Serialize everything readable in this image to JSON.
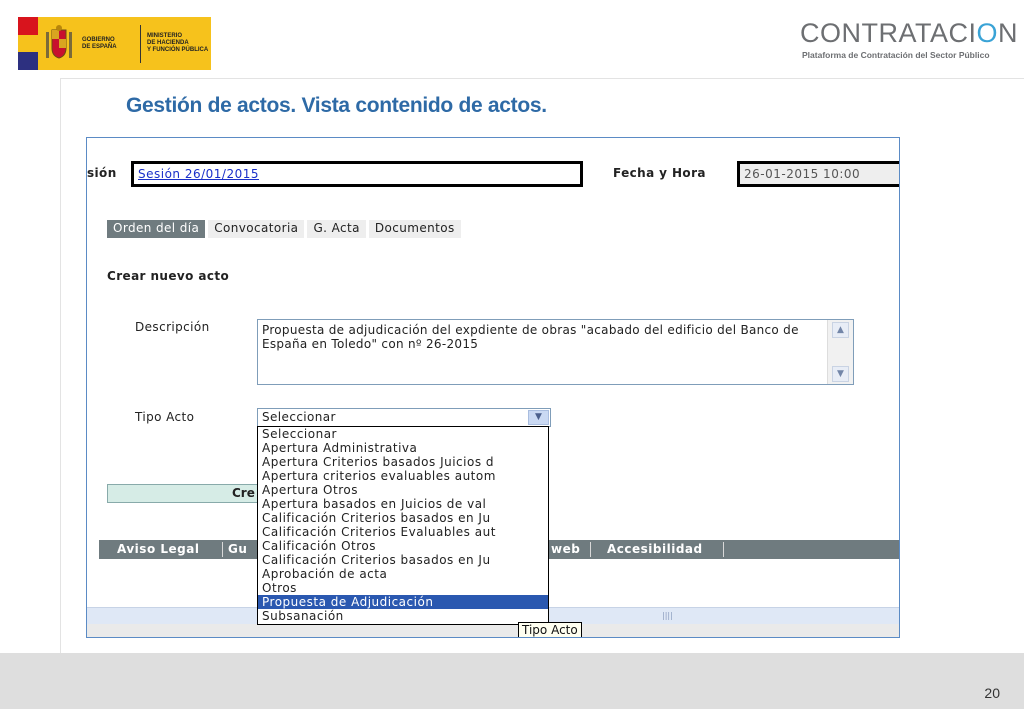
{
  "colors": {
    "title": "#2e6aa6",
    "tab_active": "#6f7b7f",
    "link": "#1a2fc9",
    "selected": "#2a58b0"
  },
  "header": {
    "gov_logo": {
      "line1": "GOBIERNO",
      "line2": "DE ESPAÑA",
      "line3": "MINISTERIO",
      "line4": "DE HACIENDA",
      "line5": "Y FUNCIÓN PÚBLICA"
    },
    "brand": {
      "title_main": "CONTRATACI",
      "title_power": "O",
      "title_end": "N",
      "subtitle": "Plataforma de Contratación del Sector Público"
    }
  },
  "slide": {
    "title": "Gestión de actos. Vista contenido de actos.",
    "page_number": "20"
  },
  "form": {
    "session_label": "sión",
    "session_value": "Sesión 26/01/2015",
    "date_label": "Fecha y Hora",
    "date_value": "26-01-2015 10:00",
    "tabs": [
      {
        "label": "Orden del día",
        "active": true
      },
      {
        "label": "Convocatoria",
        "active": false
      },
      {
        "label": "G. Acta",
        "active": false
      },
      {
        "label": "Documentos",
        "active": false
      }
    ],
    "section_title": "Crear nuevo acto",
    "description_label": "Descripción",
    "description_value": "Propuesta de adjudicación del expdiente de obras \"acabado del edificio del Banco de España en Toledo\" con nº 26-2015",
    "type_label": "Tipo Acto",
    "type_selected": "Seleccionar",
    "create_button_label": "Cre",
    "type_options": [
      "Seleccionar",
      "Apertura Administrativa",
      "Apertura Criterios basados Juicios d",
      "Apertura criterios evaluables autom",
      "Apertura Otros",
      "Apertura basados en Juicios de val",
      "Calificación Criterios basados en Ju",
      "Calificación Criterios Evaluables aut",
      "Calificación Otros",
      "Calificación Criterios basados en Ju",
      "Aprobación de acta",
      "Otros",
      "Propuesta de Adjudicación",
      "Subsanación"
    ],
    "highlighted_option_index": 12,
    "tooltip": "Tipo Acto"
  },
  "footer": {
    "items": [
      "Aviso Legal",
      "Gu",
      "web",
      "Accesibilidad"
    ]
  }
}
